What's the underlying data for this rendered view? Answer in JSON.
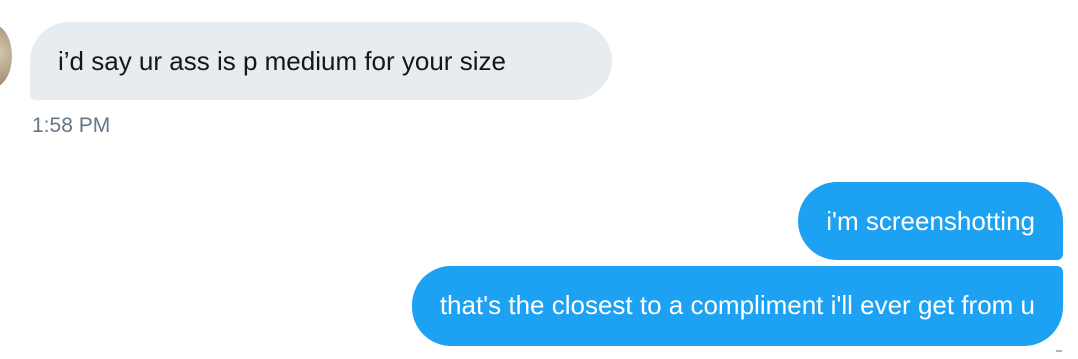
{
  "conversation": {
    "messages": [
      {
        "direction": "incoming",
        "text": "i’d say ur ass is p medium for your size"
      },
      {
        "direction": "outgoing",
        "text": "i'm screenshotting"
      },
      {
        "direction": "outgoing",
        "text": "that's the closest to a compliment i'll ever get from u"
      }
    ],
    "incoming_timestamp": "1:58 PM"
  },
  "colors": {
    "incoming_bubble": "#e6ecf0",
    "outgoing_bubble": "#1da1f2",
    "timestamp_text": "#657786"
  }
}
